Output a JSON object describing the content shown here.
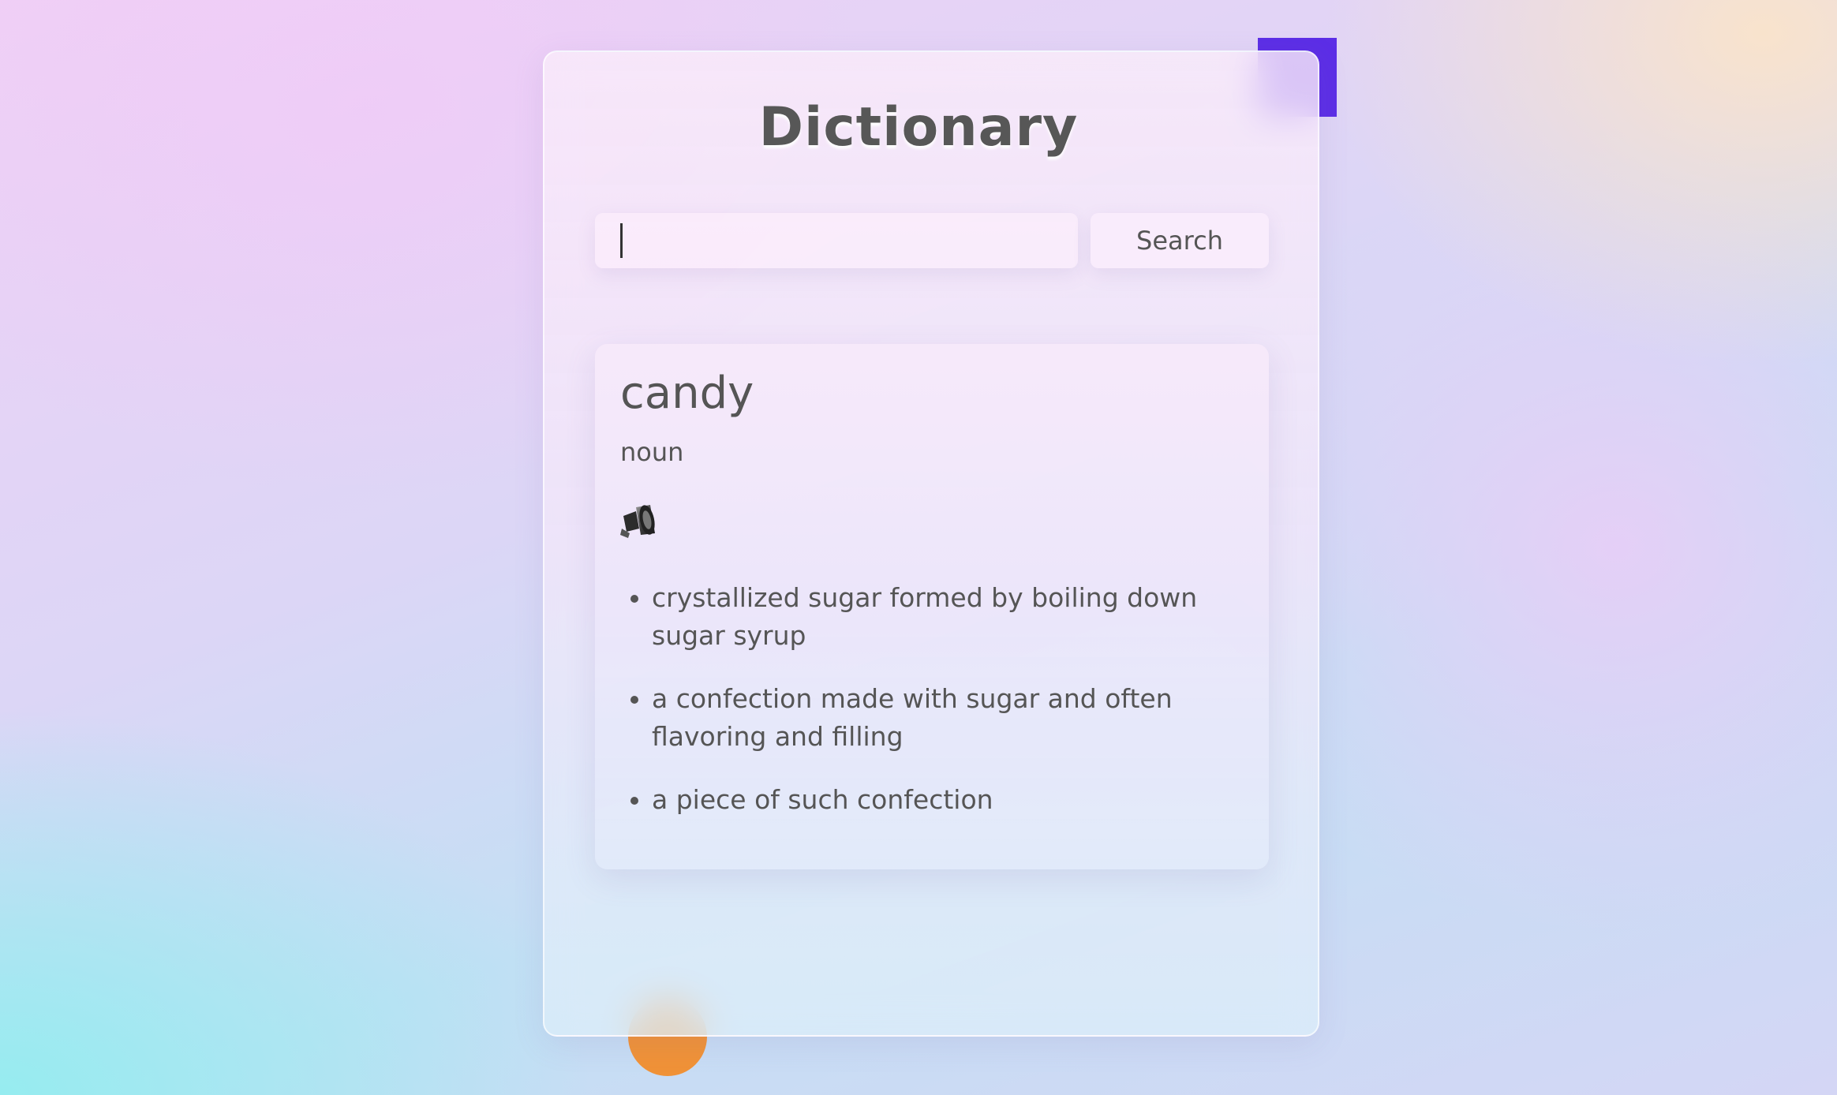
{
  "app": {
    "title": "Dictionary"
  },
  "search": {
    "value": "",
    "placeholder": "",
    "button_label": "Search"
  },
  "result": {
    "word": "candy",
    "part_of_speech": "noun",
    "audio_icon": "speaker-icon",
    "definitions": [
      "crystallized sugar formed by boiling down sugar syrup",
      "a confection made with sugar and often flavoring and filling",
      "a piece of such confection"
    ]
  },
  "colors": {
    "accent_square": "#5c2ee6",
    "accent_circle": "#f09237",
    "text": "#555555"
  }
}
